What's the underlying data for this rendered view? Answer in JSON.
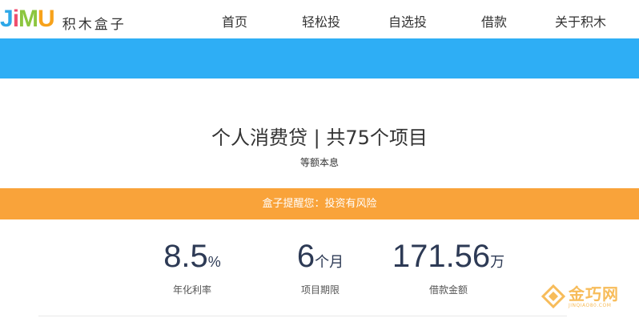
{
  "header": {
    "logo_letters": [
      "J",
      "i",
      "M",
      "U"
    ],
    "logo_text": "积木盒子",
    "nav": [
      "首页",
      "轻松投",
      "自选投",
      "借款",
      "关于积木"
    ]
  },
  "colors": {
    "banner": "#2eaef5",
    "notice": "#f9a33a",
    "stat_value": "#2d3a55"
  },
  "product": {
    "title": "个人消费贷 | 共75个项目",
    "subtitle": "等额本息"
  },
  "notice": "盒子提醒您：投资有风险",
  "stats": [
    {
      "value": "8.5",
      "unit": "%",
      "label": "年化利率"
    },
    {
      "value": "6",
      "unit": "个月",
      "label": "项目期限"
    },
    {
      "value": "171.56",
      "unit": "万",
      "label": "借款金额"
    }
  ],
  "watermark": {
    "cn": "金巧网",
    "en": "JINQIAO80.COM"
  }
}
